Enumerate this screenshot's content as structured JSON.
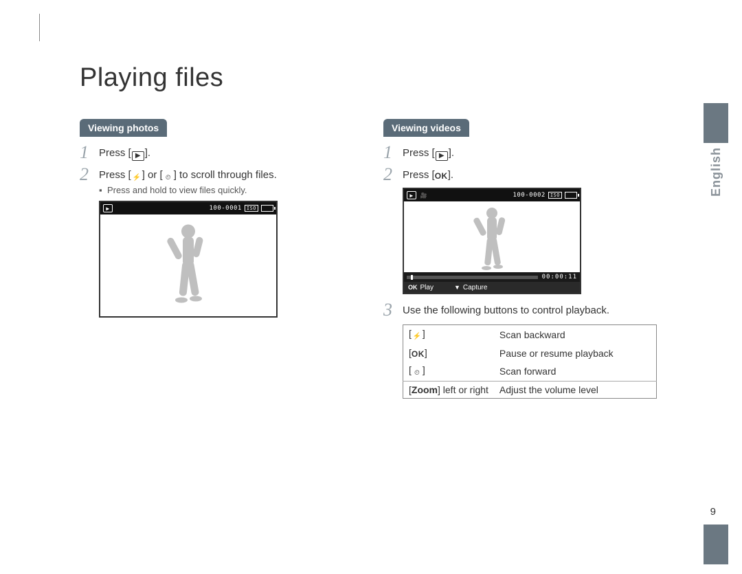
{
  "title": "Playing files",
  "language_tab": "English",
  "page_number": "9",
  "photos": {
    "heading": "Viewing photos",
    "step1": "Press [",
    "step1_end": "].",
    "step2_a": "Press [",
    "step2_b": "] or [",
    "step2_c": "] to scroll through files.",
    "bullet": "Press and hold to view files quickly.",
    "screen": {
      "file_id": "100-0001",
      "tag": "ISO"
    }
  },
  "videos": {
    "heading": "Viewing videos",
    "step1": "Press [",
    "step1_end": "].",
    "step2": "Press [",
    "step2_end": "].",
    "step3": "Use the following buttons to control playback.",
    "screen": {
      "file_id": "100-0002",
      "tag": "ISO",
      "timecode": "00:00:11",
      "hint_play_key": "OK",
      "hint_play": "Play",
      "hint_capture": "Capture"
    },
    "controls": [
      {
        "key_icon": "flash",
        "desc": "Scan backward"
      },
      {
        "key_icon": "ok",
        "desc": "Pause or resume playback"
      },
      {
        "key_icon": "timer",
        "desc": "Scan forward"
      }
    ],
    "zoom_row_key": "Zoom",
    "zoom_row_key_suffix": " left or right",
    "zoom_row_desc": "Adjust the volume level"
  },
  "icons": {
    "play": "▶",
    "flash": "⚡",
    "timer": "⏲",
    "ok": "OK",
    "down": "▼",
    "video": "🎥"
  }
}
